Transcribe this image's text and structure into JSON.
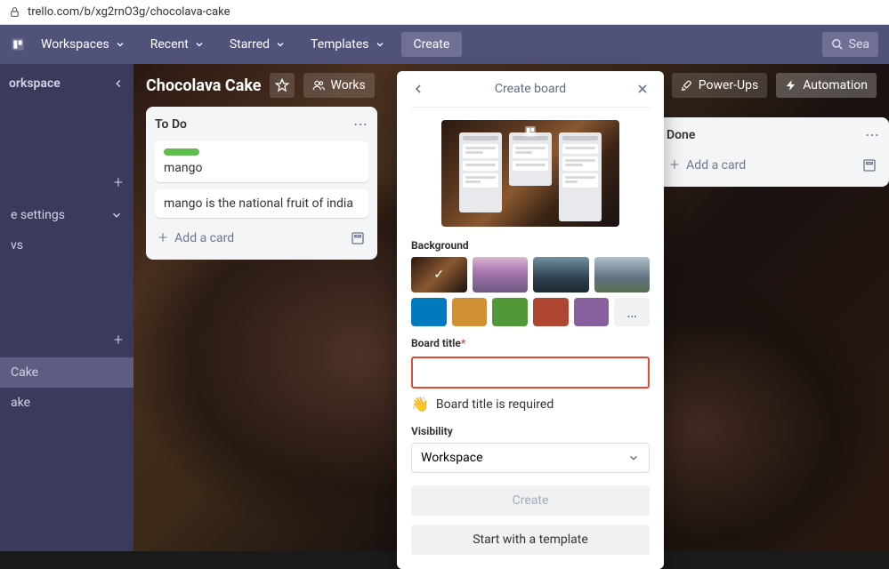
{
  "url": "trello.com/b/xg2rnO3g/chocolava-cake",
  "nav": {
    "workspaces": "Workspaces",
    "recent": "Recent",
    "starred": "Starred",
    "templates": "Templates",
    "create": "Create",
    "search_placeholder": "Sea"
  },
  "sidebar": {
    "workspace": "orkspace",
    "settings": "e settings",
    "views_label": "vs",
    "cake_active": "Cake",
    "cake_alt": "ake"
  },
  "board": {
    "title": "Chocolava Cake",
    "workspace_btn": "Works",
    "powerups": "Power-Ups",
    "automation": "Automation"
  },
  "lists": {
    "todo": {
      "title": "To Do",
      "card1": "mango",
      "card2": "mango is the national fruit of india",
      "add": "Add a card"
    },
    "done": {
      "title": "Done",
      "add": "Add a card"
    }
  },
  "popup": {
    "title": "Create board",
    "background_label": "Background",
    "colors": {
      "blue": "#0079bf",
      "orange": "#d29034",
      "green": "#519839",
      "red": "#b04632",
      "purple": "#89609e"
    },
    "board_title_label": "Board title",
    "board_title_value": "",
    "required_msg": "Board title is required",
    "visibility_label": "Visibility",
    "visibility_value": "Workspace",
    "create_btn": "Create",
    "template_btn": "Start with a template",
    "more": "…"
  }
}
